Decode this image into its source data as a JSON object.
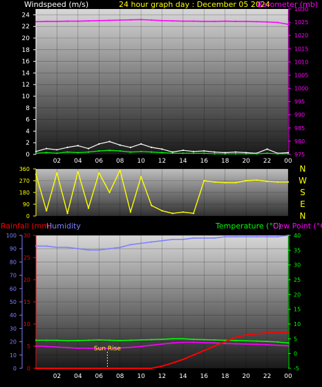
{
  "header": {
    "left_title": "Windspeed (m/s)",
    "center_title": "24 hour graph day : December 05 2024",
    "right_title": "Barometer (mb)"
  },
  "colors": {
    "windspeed": "#ffffff",
    "gust": "#00ff00",
    "barometer": "#ff00ff",
    "direction": "#ffff00",
    "rainfall": "#ff0000",
    "humidity": "#8080ff",
    "temperature": "#00ff00",
    "dewpoint": "#ff00ff",
    "sunrise": "#ffff00",
    "left_axis_title": "#ffffff",
    "barometer_axis": "#ff00ff",
    "rain_axis": "#ff0000",
    "humidity_axis": "#8080ff",
    "temp_axis": "#00ff00",
    "dew_title": "#ff00ff",
    "direction_axis": "#ffff00"
  },
  "x_ticks": [
    "02",
    "04",
    "06",
    "08",
    "10",
    "12",
    "14",
    "16",
    "18",
    "20",
    "22",
    "00"
  ],
  "direction_letters": [
    "N",
    "W",
    "S",
    "E",
    "N"
  ],
  "chart_data": [
    {
      "type": "line",
      "title": "24 hour graph day : December 05 2024",
      "ylabel": "Windspeed (m/s)",
      "ylabel_right": "Barometer (mb)",
      "ylim": [
        0,
        25
      ],
      "ylim_right": [
        975,
        1030
      ],
      "y_ticks": [
        0,
        2,
        4,
        6,
        8,
        10,
        12,
        14,
        16,
        18,
        20,
        22,
        24
      ],
      "y_ticks_right": [
        975,
        980,
        985,
        990,
        995,
        1000,
        1005,
        1010,
        1015,
        1020,
        1025,
        1030
      ],
      "x": [
        0,
        1,
        2,
        3,
        4,
        5,
        6,
        7,
        8,
        9,
        10,
        11,
        12,
        13,
        14,
        15,
        16,
        17,
        18,
        19,
        20,
        21,
        22,
        23,
        24
      ],
      "grid": true,
      "series": [
        {
          "axis": "right",
          "values": [
            1025.2,
            1025.3,
            1025.3,
            1025.4,
            1025.4,
            1025.5,
            1025.6,
            1025.7,
            1025.8,
            1025.9,
            1026.0,
            1025.8,
            1025.6,
            1025.5,
            1025.4,
            1025.4,
            1025.3,
            1025.3,
            1025.4,
            1025.3,
            1025.3,
            1025.2,
            1025.1,
            1024.9,
            1024.2
          ]
        },
        {
          "axis": "left",
          "values": [
            0.5,
            1.0,
            0.8,
            1.2,
            1.5,
            1.0,
            1.8,
            2.2,
            1.6,
            1.2,
            1.8,
            1.2,
            0.9,
            0.4,
            0.7,
            0.5,
            0.6,
            0.4,
            0.3,
            0.4,
            0.3,
            0.2,
            0.9,
            0.2,
            0.3
          ]
        },
        {
          "axis": "left",
          "values": [
            0.2,
            0.3,
            0.2,
            0.4,
            0.3,
            0.4,
            0.6,
            0.7,
            0.6,
            0.4,
            0.5,
            0.4,
            0.3,
            0.2,
            0.2,
            0.2,
            0.2,
            0.1,
            0.1,
            0.1,
            0.1,
            0.1,
            0.2,
            0.1,
            0.1
          ]
        }
      ]
    },
    {
      "type": "line",
      "ylim": [
        0,
        360
      ],
      "y_ticks": [
        0,
        90,
        180,
        270,
        360
      ],
      "x": [
        0,
        1,
        2,
        3,
        4,
        5,
        6,
        7,
        8,
        9,
        10,
        11,
        12,
        13,
        14,
        15,
        16,
        17,
        18,
        19,
        20,
        21,
        22,
        23,
        24
      ],
      "series": [
        {
          "values": [
            320,
            40,
            330,
            20,
            340,
            60,
            330,
            180,
            350,
            30,
            300,
            80,
            40,
            20,
            30,
            20,
            270,
            260,
            255,
            255,
            270,
            275,
            265,
            260,
            260
          ]
        }
      ]
    },
    {
      "type": "line",
      "ylabel": "Rainfall (mm)",
      "ylabel2": "Humidity",
      "ylabel_right": "Temperature (°C)",
      "ylabel_right2": "Dew Point (°C)",
      "ylim_rain": [
        0,
        30
      ],
      "ylim_humidity": [
        0,
        100
      ],
      "ylim_temp": [
        -5,
        40
      ],
      "y_ticks_rain": [
        0,
        5,
        10,
        15,
        20,
        25,
        30
      ],
      "y_ticks_humidity": [
        0,
        10,
        20,
        30,
        40,
        50,
        60,
        70,
        80,
        90,
        100
      ],
      "y_ticks_temp": [
        -5,
        0,
        5,
        10,
        15,
        20,
        25,
        30,
        35,
        40
      ],
      "x": [
        0,
        1,
        2,
        3,
        4,
        5,
        6,
        7,
        8,
        9,
        10,
        11,
        12,
        13,
        14,
        15,
        16,
        17,
        18,
        19,
        20,
        21,
        22,
        23,
        24
      ],
      "annotations": [
        {
          "label": "Sun Rise",
          "x": 6.8
        }
      ],
      "grid": true,
      "series": [
        {
          "axis": "rain",
          "values": [
            0,
            0,
            0,
            0,
            0,
            0,
            0,
            0,
            0,
            0,
            0,
            0,
            0.5,
            1.2,
            2.0,
            3.0,
            4.0,
            5.0,
            6.0,
            7.0,
            7.5,
            7.8,
            8.0,
            8.0,
            8.0
          ]
        },
        {
          "axis": "humidity",
          "values": [
            92,
            92,
            91,
            91,
            90,
            89,
            89,
            90,
            91,
            93,
            94,
            95,
            96,
            97,
            97,
            98,
            98,
            98,
            99,
            99,
            99,
            99,
            99,
            99,
            100
          ]
        },
        {
          "axis": "temp",
          "values": [
            4.5,
            4.5,
            4.5,
            4.3,
            4.4,
            4.5,
            4.6,
            4.5,
            4.4,
            4.5,
            4.6,
            4.7,
            4.8,
            5.0,
            5.0,
            4.8,
            4.7,
            4.6,
            4.5,
            4.4,
            4.3,
            4.2,
            4.1,
            3.9,
            3.6
          ]
        },
        {
          "axis": "temp",
          "values": [
            2.5,
            2.4,
            2.2,
            2.0,
            1.8,
            1.8,
            1.7,
            1.8,
            1.9,
            2.1,
            2.4,
            2.8,
            3.2,
            3.6,
            3.8,
            3.8,
            3.7,
            3.6,
            3.4,
            3.3,
            3.2,
            3.1,
            3.0,
            2.8,
            2.6
          ]
        }
      ]
    }
  ]
}
